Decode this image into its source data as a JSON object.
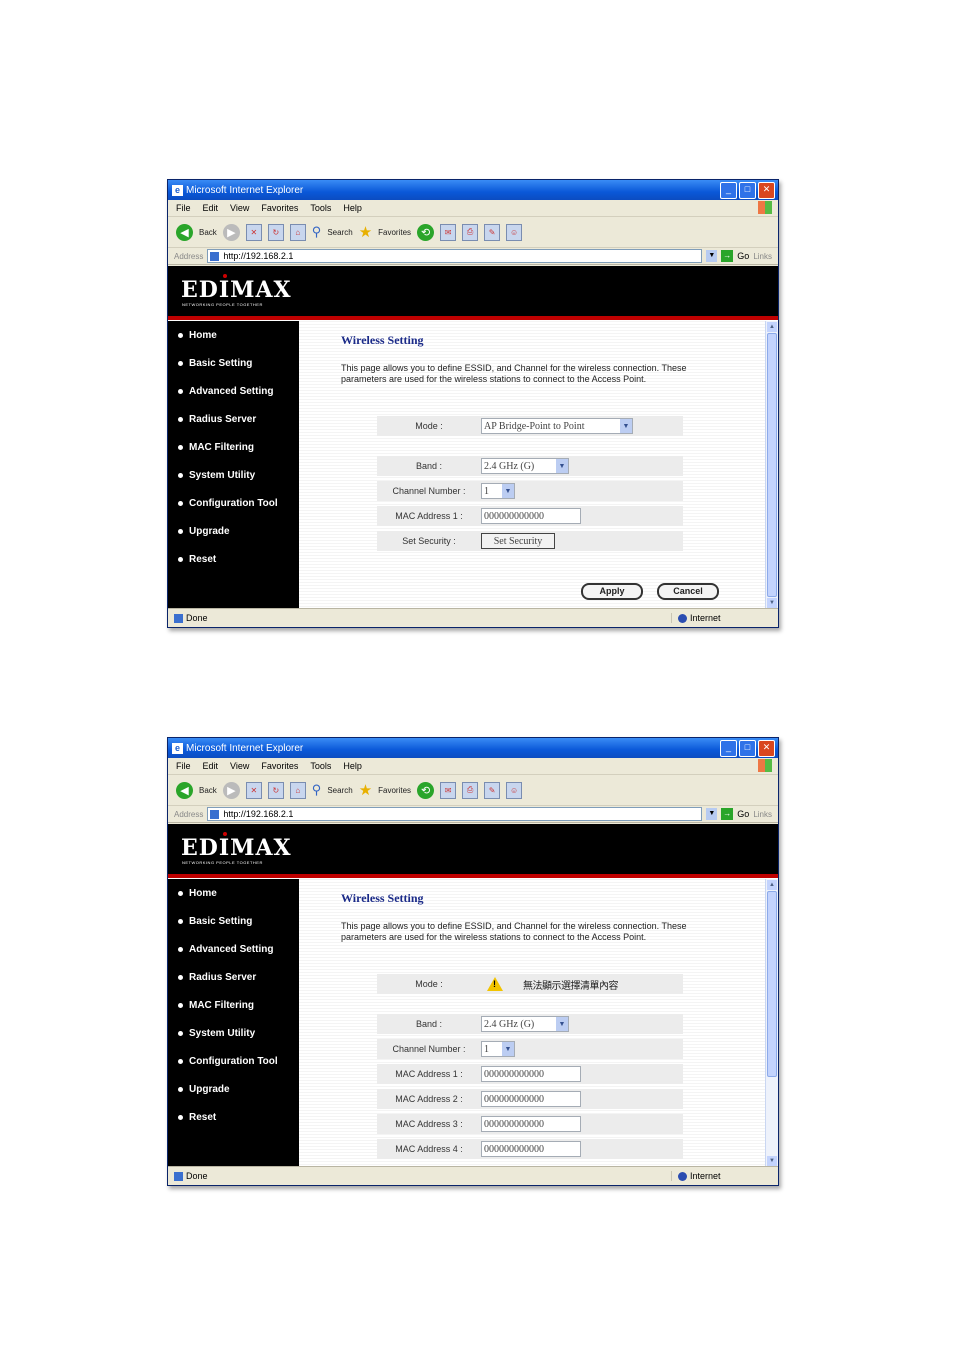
{
  "browser": {
    "title": "Microsoft Internet Explorer",
    "menu": [
      "File",
      "Edit",
      "View",
      "Favorites",
      "Tools",
      "Help"
    ],
    "toolbar": {
      "back": "Back",
      "search": "Search",
      "favorites": "Favorites"
    },
    "address_label": "Address",
    "address": "http://192.168.2.1",
    "go": "Go",
    "links": "Links",
    "status": "Done",
    "zone": "Internet"
  },
  "brand": {
    "logo": "EDIMAX",
    "tagline": "NETWORKING PEOPLE TOGETHER"
  },
  "nav": [
    "Home",
    "Basic Setting",
    "Advanced Setting",
    "Radius Server",
    "MAC Filtering",
    "System Utility",
    "Configuration Tool",
    "Upgrade",
    "Reset"
  ],
  "page": {
    "title": "Wireless Setting",
    "description": "This page allows you to define ESSID, and Channel for the wireless connection. These parameters are used for the wireless stations to connect to the Access Point."
  },
  "screen1": {
    "mode_label": "Mode :",
    "mode_value": "AP Bridge-Point to Point",
    "band_label": "Band :",
    "band_value": "2.4 GHz (G)",
    "channel_label": "Channel Number :",
    "channel_value": "1",
    "mac1_label": "MAC Address 1 :",
    "mac1_value": "000000000000",
    "security_label": "Set Security :",
    "security_button": "Set Security",
    "apply": "Apply",
    "cancel": "Cancel"
  },
  "screen2": {
    "mode_label": "Mode :",
    "mode_warning": "無法顯示選擇清單內容",
    "band_label": "Band :",
    "band_value": "2.4 GHz (G)",
    "channel_label": "Channel Number :",
    "channel_value": "1",
    "mac1_label": "MAC Address 1 :",
    "mac1_value": "000000000000",
    "mac2_label": "MAC Address 2 :",
    "mac2_value": "000000000000",
    "mac3_label": "MAC Address 3 :",
    "mac3_value": "000000000000",
    "mac4_label": "MAC Address 4 :",
    "mac4_value": "000000000000"
  },
  "icons": [
    "ie-icon",
    "minimize-icon",
    "maximize-icon",
    "close-icon",
    "back-icon",
    "forward-icon",
    "stop-icon",
    "refresh-icon",
    "home-icon",
    "search-icon",
    "favorites-icon",
    "history-icon",
    "mail-icon",
    "print-icon",
    "go-icon",
    "warning-icon",
    "globe-icon"
  ],
  "colors": {
    "banner": "#000000",
    "accent_red": "#c00000",
    "title_blue": "#1a2a88"
  }
}
